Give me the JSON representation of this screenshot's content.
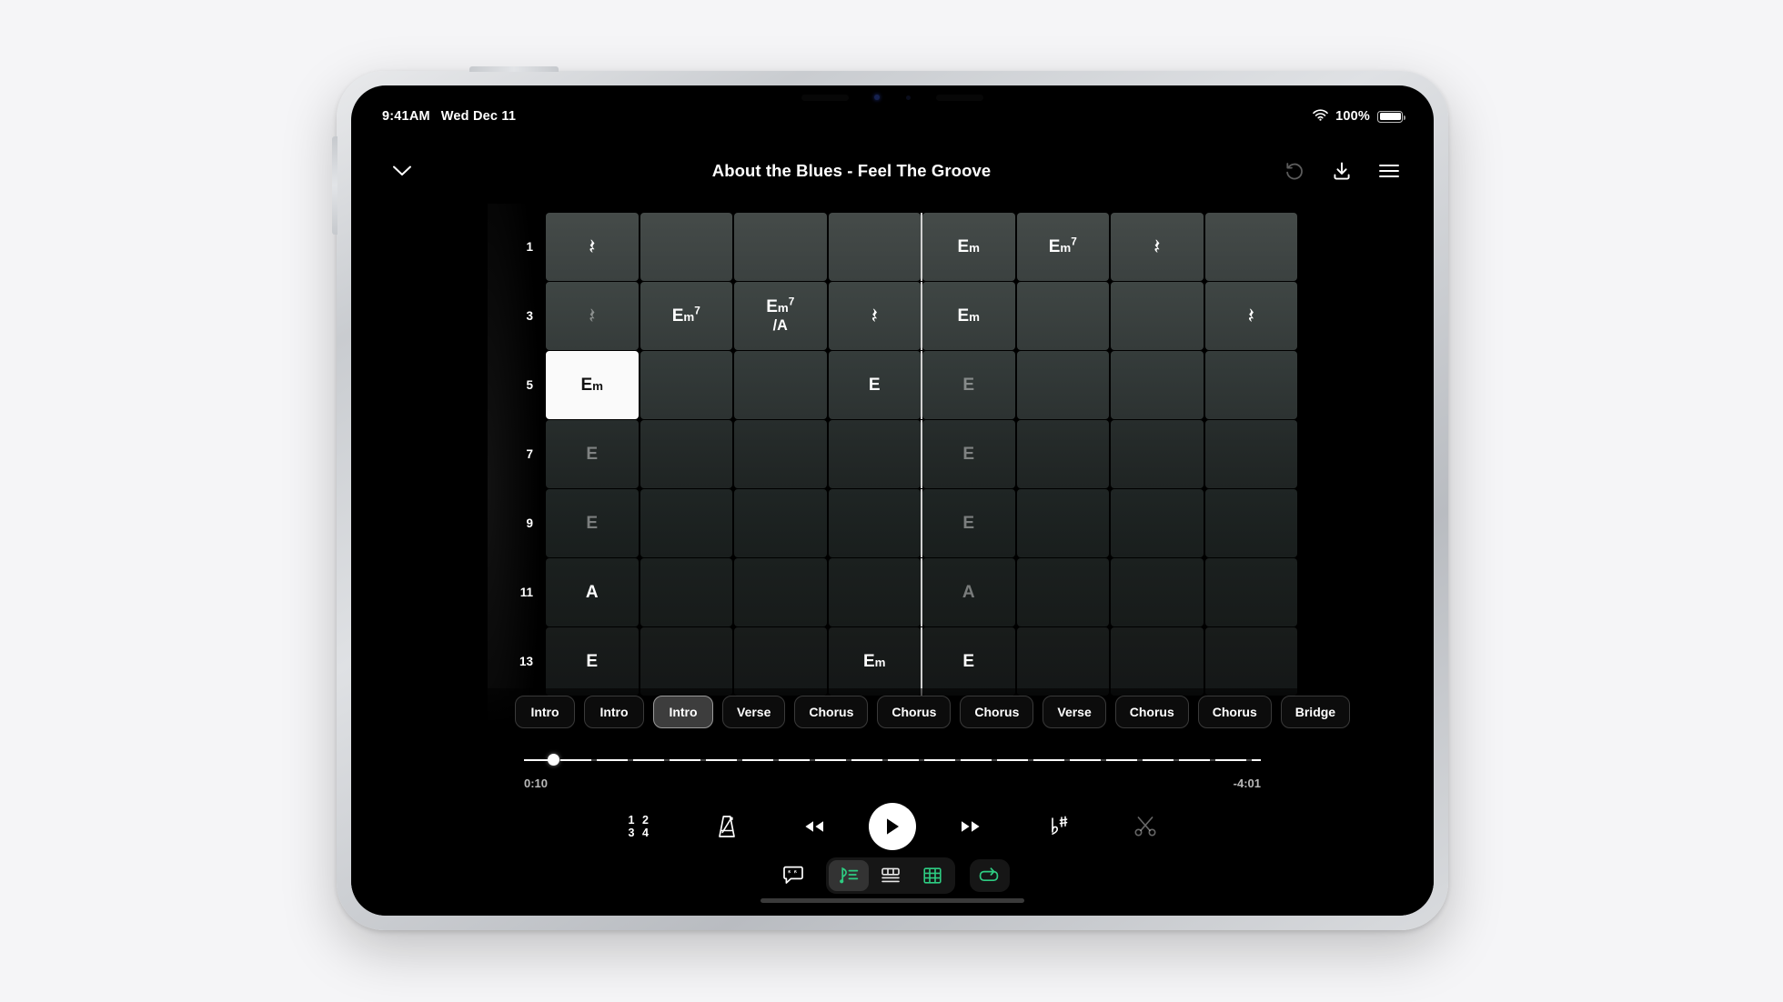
{
  "status_bar": {
    "time": "9:41AM",
    "date": "Wed Dec 11",
    "battery_percent": "100%",
    "wifi_icon": "wifi-icon",
    "battery_icon": "battery-full-icon"
  },
  "header": {
    "collapse_icon": "chevron-down-icon",
    "title": "About the Blues - Feel The Groove",
    "undo_icon": "undo-icon",
    "download_icon": "download-icon",
    "menu_icon": "hamburger-menu-icon"
  },
  "chord_grid": {
    "beats_per_bar": 4,
    "bar_line_column": 5,
    "rows": [
      {
        "number": "1",
        "cells": [
          {
            "text": "rest"
          },
          {
            "text": ""
          },
          {
            "text": ""
          },
          {
            "text": ""
          },
          {
            "root": "E",
            "quality": "m",
            "barline": true
          },
          {
            "root": "E",
            "quality": "m",
            "sup": "7"
          },
          {
            "text": "rest"
          },
          {
            "text": ""
          }
        ]
      },
      {
        "number": "3",
        "cells": [
          {
            "text": "rest",
            "dim": true
          },
          {
            "root": "E",
            "quality": "m",
            "sup": "7"
          },
          {
            "root": "E",
            "quality": "m",
            "sup": "7",
            "bass": "/A"
          },
          {
            "text": "rest"
          },
          {
            "root": "E",
            "quality": "m",
            "barline": true
          },
          {
            "text": ""
          },
          {
            "text": ""
          },
          {
            "text": "rest"
          }
        ]
      },
      {
        "number": "5",
        "cells": [
          {
            "root": "E",
            "quality": "m",
            "active": true
          },
          {
            "text": ""
          },
          {
            "text": ""
          },
          {
            "root": "E"
          },
          {
            "root": "E",
            "dim": true,
            "barline": true
          },
          {
            "text": ""
          },
          {
            "text": ""
          },
          {
            "text": ""
          }
        ]
      },
      {
        "number": "7",
        "cells": [
          {
            "root": "E",
            "dim": true
          },
          {
            "text": ""
          },
          {
            "text": ""
          },
          {
            "text": ""
          },
          {
            "root": "E",
            "dim": true,
            "barline": true
          },
          {
            "text": ""
          },
          {
            "text": ""
          },
          {
            "text": ""
          }
        ]
      },
      {
        "number": "9",
        "cells": [
          {
            "root": "E",
            "dim": true
          },
          {
            "text": ""
          },
          {
            "text": ""
          },
          {
            "text": ""
          },
          {
            "root": "E",
            "dim": true,
            "barline": true
          },
          {
            "text": ""
          },
          {
            "text": ""
          },
          {
            "text": ""
          }
        ]
      },
      {
        "number": "11",
        "cells": [
          {
            "root": "A"
          },
          {
            "text": ""
          },
          {
            "text": ""
          },
          {
            "text": ""
          },
          {
            "root": "A",
            "dim": true,
            "barline": true
          },
          {
            "text": ""
          },
          {
            "text": ""
          },
          {
            "text": ""
          }
        ]
      },
      {
        "number": "13",
        "cells": [
          {
            "root": "E"
          },
          {
            "text": ""
          },
          {
            "text": ""
          },
          {
            "root": "E",
            "quality": "m"
          },
          {
            "root": "E",
            "barline": true
          },
          {
            "text": ""
          },
          {
            "text": ""
          },
          {
            "text": ""
          }
        ]
      }
    ]
  },
  "sections": [
    {
      "label": "Intro",
      "active": false
    },
    {
      "label": "Intro",
      "active": false
    },
    {
      "label": "Intro",
      "active": true
    },
    {
      "label": "Verse",
      "active": false
    },
    {
      "label": "Chorus",
      "active": false
    },
    {
      "label": "Chorus",
      "active": false
    },
    {
      "label": "Chorus",
      "active": false
    },
    {
      "label": "Verse",
      "active": false
    },
    {
      "label": "Chorus",
      "active": false
    },
    {
      "label": "Chorus",
      "active": false
    },
    {
      "label": "Bridge",
      "active": false
    }
  ],
  "player": {
    "elapsed": "0:10",
    "remaining": "-4:01",
    "progress_percent": 3.2,
    "count_in_top": "1 2",
    "count_in_bottom": "3 4",
    "count_in_icon": "count-in-icon",
    "metronome_icon": "metronome-icon",
    "rewind_icon": "rewind-icon",
    "play_icon": "play-icon",
    "forward_icon": "fast-forward-icon",
    "transpose_icon": "transpose-flat-sharp-icon",
    "trim_icon": "scissors-icon"
  },
  "view_bar": {
    "lyrics_icon": "lyrics-bubble-icon",
    "notation_icon": "notation-staff-icon",
    "tab_icon": "tablature-icon",
    "grid_icon": "chord-grid-icon",
    "loop_icon": "loop-icon",
    "active_view": "notation"
  },
  "colors": {
    "accent_green": "#2ecc82",
    "active_cell": "#fafafa",
    "page_background": "#f5f5f7"
  },
  "home_indicator": "home-indicator"
}
